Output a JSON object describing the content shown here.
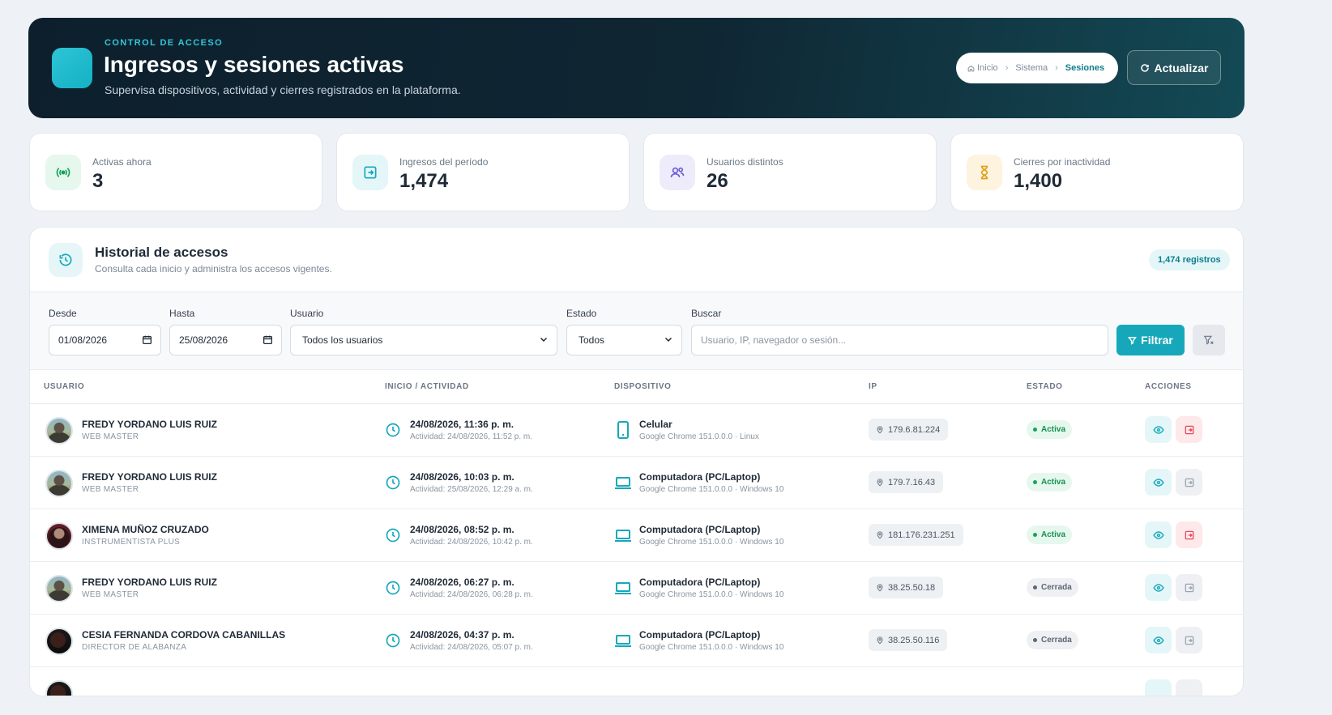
{
  "header": {
    "eyebrow": "CONTROL DE ACCESO",
    "title": "Ingresos y sesiones activas",
    "subtitle": "Supervisa dispositivos, actividad y cierres registrados en la plataforma.",
    "breadcrumb": [
      "Inicio",
      "Sistema",
      "Sesiones"
    ],
    "refresh_label": "Actualizar"
  },
  "stats": [
    {
      "label": "Activas ahora",
      "value": "3",
      "icon": "broadcast-icon",
      "color": "#16a35b"
    },
    {
      "label": "Ingresos del período",
      "value": "1,474",
      "icon": "login-icon",
      "color": "#16a8ba"
    },
    {
      "label": "Usuarios distintos",
      "value": "26",
      "icon": "users-icon",
      "color": "#6b5bd6"
    },
    {
      "label": "Cierres por inactividad",
      "value": "1,400",
      "icon": "hourglass-icon",
      "color": "#e0a11b"
    }
  ],
  "history": {
    "title": "Historial de accesos",
    "subtitle": "Consulta cada inicio y administra los accesos vigentes.",
    "count_badge": "1,474 registros"
  },
  "filters": {
    "from_label": "Desde",
    "from_value": "01/08/2026",
    "to_label": "Hasta",
    "to_value": "25/08/2026",
    "user_label": "Usuario",
    "user_value": "Todos los usuarios",
    "state_label": "Estado",
    "state_value": "Todos",
    "search_label": "Buscar",
    "search_placeholder": "Usuario, IP, navegador o sesión...",
    "filter_button": "Filtrar"
  },
  "table": {
    "columns": [
      "USUARIO",
      "INICIO / ACTIVIDAD",
      "DISPOSITIVO",
      "IP",
      "ESTADO",
      "ACCIONES"
    ],
    "rows": [
      {
        "name": "FREDY YORDANO LUIS RUIZ",
        "role": "WEB MASTER",
        "start": "24/08/2026, 11:36 p. m.",
        "activity": "Actividad: 24/08/2026, 11:52 p. m.",
        "device": "Celular",
        "device_icon": "phone-icon",
        "browser": "Google Chrome 151.0.0.0 · Linux",
        "ip": "179.6.81.224",
        "status": "Activa",
        "active": true
      },
      {
        "name": "FREDY YORDANO LUIS RUIZ",
        "role": "WEB MASTER",
        "start": "24/08/2026, 10:03 p. m.",
        "activity": "Actividad: 25/08/2026, 12:29 a. m.",
        "device": "Computadora (PC/Laptop)",
        "device_icon": "laptop-icon",
        "browser": "Google Chrome 151.0.0.0 · Windows 10",
        "ip": "179.7.16.43",
        "status": "Activa",
        "active": true
      },
      {
        "name": "XIMENA MUÑOZ CRUZADO",
        "role": "INSTRUMENTISTA PLUS",
        "start": "24/08/2026, 08:52 p. m.",
        "activity": "Actividad: 24/08/2026, 10:42 p. m.",
        "device": "Computadora (PC/Laptop)",
        "device_icon": "laptop-icon",
        "browser": "Google Chrome 151.0.0.0 · Windows 10",
        "ip": "181.176.231.251",
        "status": "Activa",
        "active": true
      },
      {
        "name": "FREDY YORDANO LUIS RUIZ",
        "role": "WEB MASTER",
        "start": "24/08/2026, 06:27 p. m.",
        "activity": "Actividad: 24/08/2026, 06:28 p. m.",
        "device": "Computadora (PC/Laptop)",
        "device_icon": "laptop-icon",
        "browser": "Google Chrome 151.0.0.0 · Windows 10",
        "ip": "38.25.50.18",
        "status": "Cerrada",
        "active": false
      },
      {
        "name": "CESIA FERNANDA CORDOVA CABANILLAS",
        "role": "DIRECTOR DE ALABANZA",
        "start": "24/08/2026, 04:37 p. m.",
        "activity": "Actividad: 24/08/2026, 05:07 p. m.",
        "device": "Computadora (PC/Laptop)",
        "device_icon": "laptop-icon",
        "browser": "Google Chrome 151.0.0.0 · Windows 10",
        "ip": "38.25.50.116",
        "status": "Cerrada",
        "active": false
      }
    ]
  }
}
